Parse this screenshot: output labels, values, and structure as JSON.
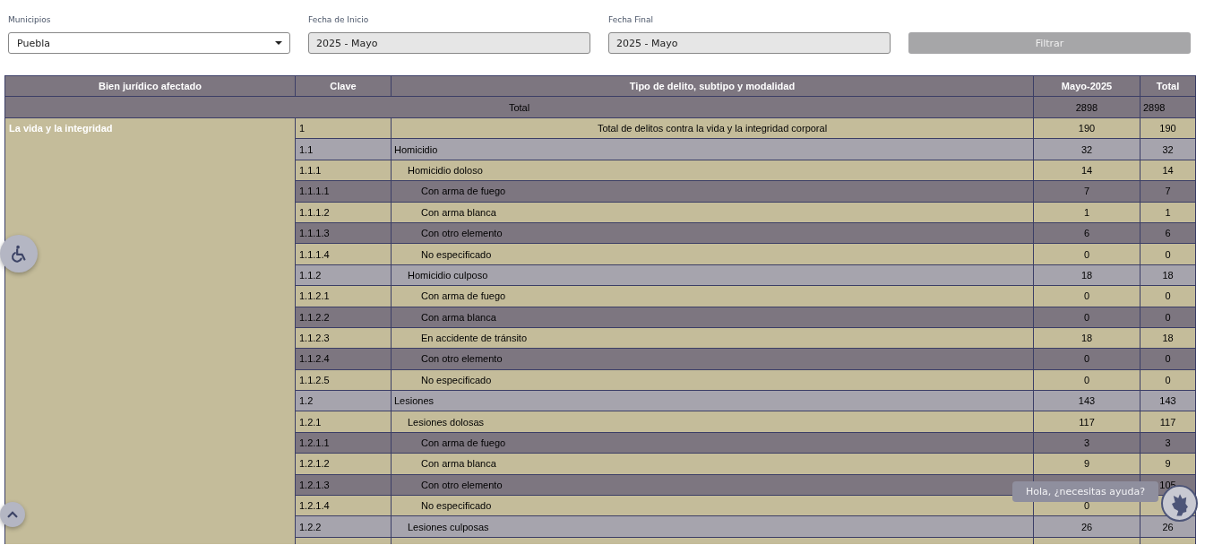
{
  "filters": [
    {
      "label": "Municipios",
      "value": "Puebla",
      "kind": "select"
    },
    {
      "label": "Fecha de Inicio",
      "value": "2025 - Mayo",
      "kind": "readonly"
    },
    {
      "label": "Fecha Final",
      "value": "2025 - Mayo",
      "kind": "readonly"
    }
  ],
  "filter_button": {
    "label": "Filtrar",
    "disabled": true
  },
  "table": {
    "columns": [
      "Bien jurídico afectado",
      "Clave",
      "Tipo de delito, subtipo y modalidad",
      "Mayo-2025",
      "Total"
    ],
    "total_row": {
      "label": "Total",
      "mayo": "2898",
      "total": "2898"
    },
    "group": {
      "label": "La vida y la integridad",
      "rows": [
        {
          "clave": "1",
          "tipo": "Total de delitos contra la vida y la integridad corporal",
          "mayo": "190",
          "total": "190",
          "color": "#c4bc9a",
          "children": [
            {
              "clave": "1.1",
              "tipo": "Homicidio",
              "mayo": "32",
              "total": "32",
              "color": "#a6a4ad",
              "children": [
                {
                  "clave": "1.1.1",
                  "tipo": "Homicidio doloso",
                  "mayo": "14",
                  "total": "14",
                  "color": "#c4bc9a",
                  "children": [
                    {
                      "clave": "1.1.1.1",
                      "tipo": "Con arma de fuego",
                      "mayo": "7",
                      "total": "7",
                      "color": "#7d7680"
                    },
                    {
                      "clave": "1.1.1.2",
                      "tipo": "Con arma blanca",
                      "mayo": "1",
                      "total": "1",
                      "color": "#c4bc9a"
                    },
                    {
                      "clave": "1.1.1.3",
                      "tipo": "Con otro elemento",
                      "mayo": "6",
                      "total": "6",
                      "color": "#7d7680"
                    },
                    {
                      "clave": "1.1.1.4",
                      "tipo": "No especificado",
                      "mayo": "0",
                      "total": "0",
                      "color": "#c4bc9a"
                    }
                  ]
                },
                {
                  "clave": "1.1.2",
                  "tipo": "Homicidio culposo",
                  "mayo": "18",
                  "total": "18",
                  "color": "#a6a4ad",
                  "children": [
                    {
                      "clave": "1.1.2.1",
                      "tipo": "Con arma de fuego",
                      "mayo": "0",
                      "total": "0",
                      "color": "#c4bc9a"
                    },
                    {
                      "clave": "1.1.2.2",
                      "tipo": "Con arma blanca",
                      "mayo": "0",
                      "total": "0",
                      "color": "#7d7680"
                    },
                    {
                      "clave": "1.1.2.3",
                      "tipo": "En accidente de tránsito",
                      "mayo": "18",
                      "total": "18",
                      "color": "#c4bc9a"
                    },
                    {
                      "clave": "1.1.2.4",
                      "tipo": "Con otro elemento",
                      "mayo": "0",
                      "total": "0",
                      "color": "#7d7680"
                    },
                    {
                      "clave": "1.1.2.5",
                      "tipo": "No especificado",
                      "mayo": "0",
                      "total": "0",
                      "color": "#c4bc9a"
                    }
                  ]
                }
              ]
            },
            {
              "clave": "1.2",
              "tipo": "Lesiones",
              "mayo": "143",
              "total": "143",
              "color": "#a6a4ad",
              "children": [
                {
                  "clave": "1.2.1",
                  "tipo": "Lesiones dolosas",
                  "mayo": "117",
                  "total": "117",
                  "color": "#c4bc9a",
                  "children": [
                    {
                      "clave": "1.2.1.1",
                      "tipo": "Con arma de fuego",
                      "mayo": "3",
                      "total": "3",
                      "color": "#7d7680"
                    },
                    {
                      "clave": "1.2.1.2",
                      "tipo": "Con arma blanca",
                      "mayo": "9",
                      "total": "9",
                      "color": "#c4bc9a"
                    },
                    {
                      "clave": "1.2.1.3",
                      "tipo": "Con otro elemento",
                      "total": "105",
                      "color": "#7d7680"
                    },
                    {
                      "clave": "1.2.1.4",
                      "tipo": "No especificado",
                      "mayo": "0",
                      "color": "#c4bc9a"
                    }
                  ]
                },
                {
                  "clave": "1.2.2",
                  "tipo": "Lesiones culposas",
                  "mayo": "26",
                  "total": "26",
                  "color": "#a6a4ad"
                }
              ]
            }
          ]
        }
      ]
    }
  },
  "chat": {
    "bubble": "Hola, ¿necesitas ayuda?"
  }
}
